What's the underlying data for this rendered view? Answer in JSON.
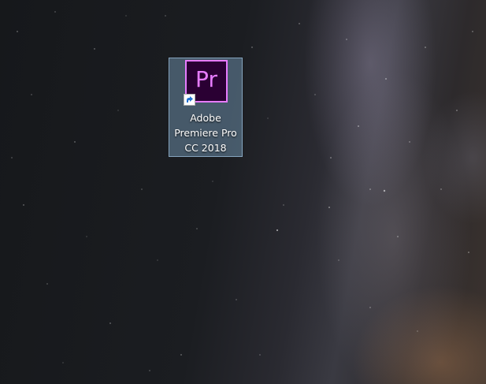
{
  "desktop": {
    "shortcuts": [
      {
        "label": "Adobe\nPremiere Pro\nCC 2018",
        "logo_text": "Pr",
        "logo_icon": "adobe-premiere-pro-icon",
        "overlay_icon": "shortcut-arrow-icon",
        "selected": true,
        "colors": {
          "logo_background": "#2a0033",
          "logo_accent": "#e77cff",
          "selection": "#7ca4c4"
        }
      }
    ]
  }
}
